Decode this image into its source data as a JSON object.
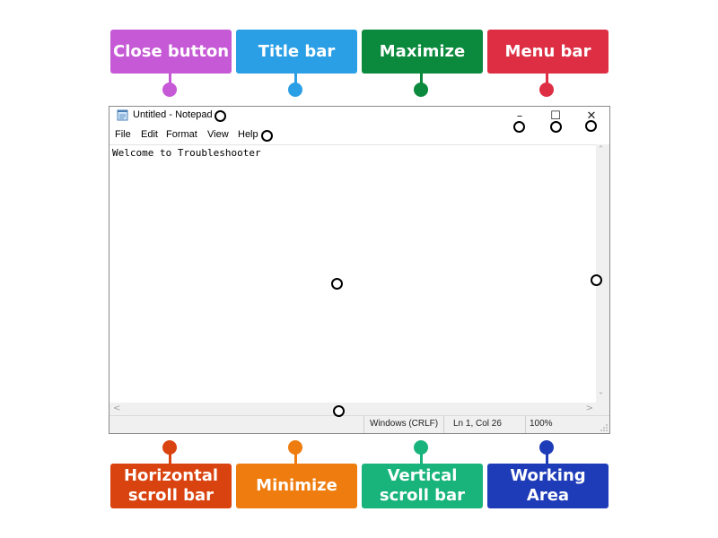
{
  "labels": {
    "top": [
      {
        "text": "Close button",
        "color": "#c65ad6"
      },
      {
        "text": "Title bar",
        "color": "#2b9fe6"
      },
      {
        "text": "Maximize",
        "color": "#0b8a3d"
      },
      {
        "text": "Menu bar",
        "color": "#dd2e44"
      }
    ],
    "bottom": [
      {
        "line1": "Horizontal",
        "line2": "scroll bar",
        "color": "#d9430f"
      },
      {
        "line1": "Minimize",
        "line2": "",
        "color": "#ef7c0e"
      },
      {
        "line1": "Vertical",
        "line2": "scroll bar",
        "color": "#18b47b"
      },
      {
        "line1": "Working",
        "line2": "Area",
        "color": "#1f3cb8"
      }
    ]
  },
  "window": {
    "title": "Untitled - Notepad",
    "icon": "notepad-icon",
    "controls": {
      "minimize": "–",
      "maximize": "☐",
      "close": "✕"
    },
    "menu": [
      "File",
      "Edit",
      "Format",
      "View",
      "Help"
    ],
    "content": "Welcome to Troubleshooter",
    "scroll_arrows": {
      "up": "˄",
      "down": "˅",
      "left": "<",
      "right": ">"
    },
    "status": {
      "encoding": "Windows (CRLF)",
      "position": "Ln 1, Col 26",
      "zoom": "100%"
    }
  }
}
